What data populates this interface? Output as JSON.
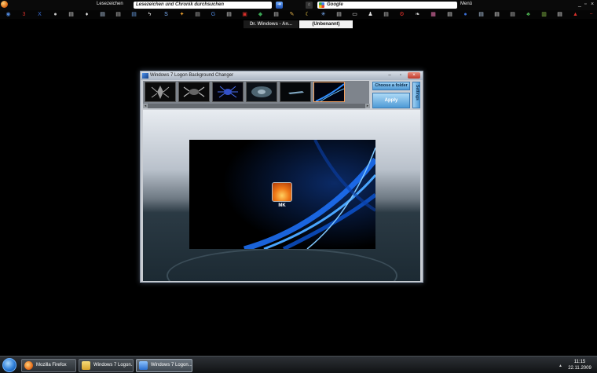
{
  "browser": {
    "bookmarks_label": "Lesezeichen",
    "bookmarks_search_placeholder": "Lesezeichen und Chronik durchsuchen",
    "google_search_placeholder": "Google",
    "menu_label": "Menü",
    "window_controls": {
      "minimize": "_",
      "maximize": "▫",
      "close": "×"
    },
    "bookmark_icons": [
      {
        "icon": "firefox-icon",
        "glyph": "◉",
        "color": "#4f86d9"
      },
      {
        "icon": "red-3-icon",
        "glyph": "3",
        "color": "#d4302a"
      },
      {
        "icon": "x-icon",
        "glyph": "X",
        "color": "#3a6fd8"
      },
      {
        "icon": "circle-icon",
        "glyph": "●",
        "color": "#c9c9c9"
      },
      {
        "icon": "page-icon",
        "glyph": "▤",
        "color": "#d8d8d8"
      },
      {
        "icon": "drink-icon",
        "glyph": "♦",
        "color": "#e2e2e2"
      },
      {
        "icon": "page-icon",
        "glyph": "▤",
        "color": "#bcd3ef"
      },
      {
        "icon": "page-icon",
        "glyph": "▤",
        "color": "#c5c5c5"
      },
      {
        "icon": "page-icon",
        "glyph": "▤",
        "color": "#6a9ee0"
      },
      {
        "icon": "lightning-icon",
        "glyph": "ϟ",
        "color": "#e6e6e6"
      },
      {
        "icon": "s-icon",
        "glyph": "S",
        "color": "#7fb4ff"
      },
      {
        "icon": "color-dots-icon",
        "glyph": "✦",
        "color": "#f3a530"
      },
      {
        "icon": "page-icon",
        "glyph": "▤",
        "color": "#b5b5b5"
      },
      {
        "icon": "g-icon",
        "glyph": "G",
        "color": "#4f86d9"
      },
      {
        "icon": "page-icon",
        "glyph": "▤",
        "color": "#d8d8d8"
      },
      {
        "icon": "pdf-icon",
        "glyph": "▣",
        "color": "#d9302a"
      },
      {
        "icon": "shield-icon",
        "glyph": "◆",
        "color": "#3aa655"
      },
      {
        "icon": "page-icon",
        "glyph": "▤",
        "color": "#cfcfcf"
      },
      {
        "icon": "pencil-icon",
        "glyph": "✎",
        "color": "#e7b34a"
      },
      {
        "icon": "moon-icon",
        "glyph": "☾",
        "color": "#f5d04a"
      },
      {
        "icon": "star-icon",
        "glyph": "✳",
        "color": "#7fb4ff"
      },
      {
        "icon": "page-icon",
        "glyph": "▤",
        "color": "#cfcfcf"
      },
      {
        "icon": "tv-icon",
        "glyph": "▭",
        "color": "#e2e2e2"
      },
      {
        "icon": "chess-icon",
        "glyph": "♟",
        "color": "#e2e2e2"
      },
      {
        "icon": "page-icon",
        "glyph": "▤",
        "color": "#c5c5c5"
      },
      {
        "icon": "gear-icon",
        "glyph": "⚙",
        "color": "#d9302a"
      },
      {
        "icon": "bird-icon",
        "glyph": "❧",
        "color": "#e2e2e2"
      },
      {
        "icon": "grid-icon",
        "glyph": "▦",
        "color": "#e06fa8"
      },
      {
        "icon": "page-icon",
        "glyph": "▤",
        "color": "#e2e2e2"
      },
      {
        "icon": "ball-icon",
        "glyph": "●",
        "color": "#3a6fd8"
      },
      {
        "icon": "page-icon",
        "glyph": "▤",
        "color": "#bcd3ef"
      },
      {
        "icon": "page-icon",
        "glyph": "▤",
        "color": "#e2e2e2"
      },
      {
        "icon": "page-icon",
        "glyph": "▤",
        "color": "#c5c5c5"
      },
      {
        "icon": "puzzle-icon",
        "glyph": "♣",
        "color": "#4caf50"
      },
      {
        "icon": "bars-icon",
        "glyph": "▥",
        "color": "#8bc34a"
      },
      {
        "icon": "page-icon",
        "glyph": "▤",
        "color": "#e2e2e2"
      },
      {
        "icon": "adobe-icon",
        "glyph": "▲",
        "color": "#d9302a"
      },
      {
        "icon": "minus-icon",
        "glyph": "−",
        "color": "#d9302a"
      }
    ],
    "tabs": [
      {
        "label": "Dr. Windows - An...",
        "active": false
      },
      {
        "label": "(Unbenannt)",
        "active": true
      }
    ]
  },
  "app": {
    "title": "Windows 7 Logon Background Changer",
    "titlebar_buttons": {
      "minimize": "–",
      "maximize": "▫",
      "close": "×"
    },
    "thumbnails": [
      {
        "name": "creature-thumb",
        "selected": false
      },
      {
        "name": "insect-thumb",
        "selected": false
      },
      {
        "name": "spider-thumb",
        "selected": false
      },
      {
        "name": "disc-thumb",
        "selected": false
      },
      {
        "name": "ship-thumb",
        "selected": false
      },
      {
        "name": "aurora-thumb",
        "selected": true
      }
    ],
    "choose_folder_label": "Choose a folder",
    "apply_label": "Apply",
    "settings_label": "Settings",
    "scroll_left": "◂",
    "scroll_right": "▸",
    "preview": {
      "user_name": "MK"
    }
  },
  "taskbar": {
    "items": [
      {
        "label": "Mozilla Firefox",
        "icon": "firefox-icon",
        "color": "#e9731f",
        "active": false
      },
      {
        "label": "Windows 7 Logon...",
        "icon": "folder-icon",
        "color": "#e8c34a",
        "active": false
      },
      {
        "label": "Windows 7 Logon...",
        "icon": "app-window-icon",
        "color": "#3b86e0",
        "active": true
      }
    ],
    "tray_arrow": "▲",
    "clock_time": "11:15",
    "clock_date": "22.11.2009"
  }
}
